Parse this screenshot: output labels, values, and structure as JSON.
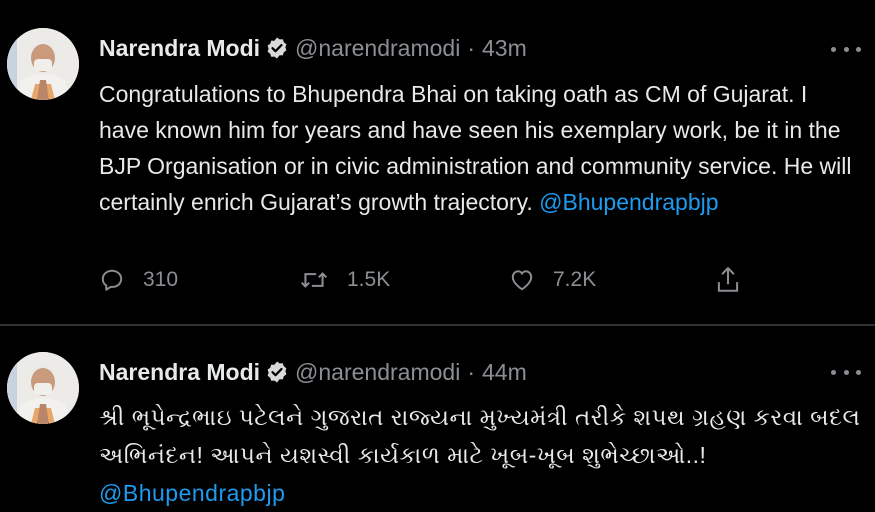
{
  "colors": {
    "background": "#000000",
    "text": "#e7e9ea",
    "muted": "#8b8f94",
    "mention": "#1d9bf0",
    "divider": "#2f3336"
  },
  "tweets": [
    {
      "author_name": "Narendra Modi",
      "handle": "@narendramodi",
      "separator": "·",
      "time": "43m",
      "text": "Congratulations to Bhupendra Bhai on taking oath as CM of Gujarat. I have known him for years and have seen his exemplary work, be it in the BJP Organisation or in civic administration and community service. He will certainly enrich Gujarat’s growth trajectory.",
      "mention": "@Bhupendrapbjp",
      "reply_count": "310",
      "retweet_count": "1.5K",
      "like_count": "7.2K",
      "icons": [
        "reply-icon",
        "retweet-icon",
        "like-icon",
        "share-icon",
        "more-icon",
        "verified-badge-icon"
      ]
    },
    {
      "author_name": "Narendra Modi",
      "handle": "@narendramodi",
      "separator": "·",
      "time": "44m",
      "text": "શ્રી ભૂપેન્દ્રભાઇ પટેલને ગુજરાત રાજ્યના મુખ્યમંત્રી તરીકે શપથ ગ્રહણ કરવા બદલ અભિનંદન! આપને યશસ્વી કાર્યકાળ માટે ખૂબ-ખૂબ શુભેચ્છાઓ..!",
      "mention": "@Bhupendrapbjp",
      "icons": [
        "more-icon",
        "verified-badge-icon"
      ]
    }
  ]
}
